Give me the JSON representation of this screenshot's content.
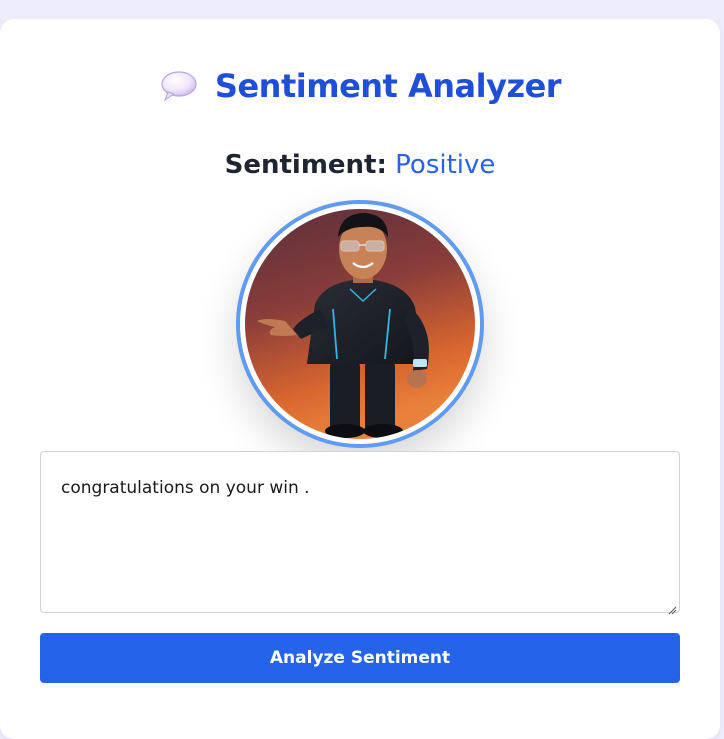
{
  "app": {
    "title": "Sentiment Analyzer",
    "title_icon": "speech-bubble-icon"
  },
  "result": {
    "label": "Sentiment:",
    "value": "Positive"
  },
  "avatar": {
    "description": "cartoon-man-avatar"
  },
  "input": {
    "value": "congratulations on your win ."
  },
  "actions": {
    "analyze_label": "Analyze Sentiment"
  },
  "colors": {
    "accent": "#2563eb",
    "title": "#1f4fd8",
    "ring": "#5f9bf1",
    "background": "#eeedfb"
  }
}
